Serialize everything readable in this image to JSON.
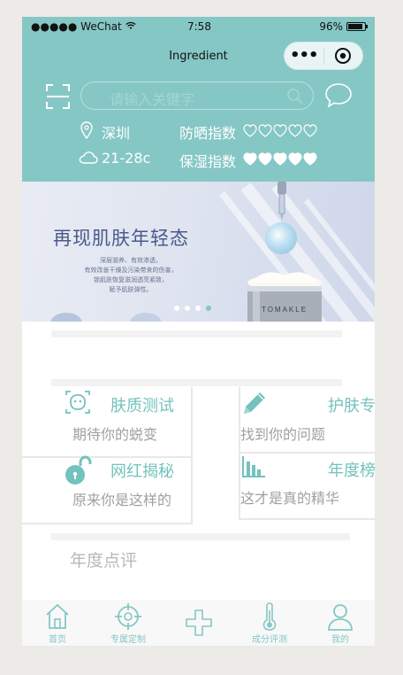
{
  "status": {
    "carrier": "●●●●● WeChat",
    "time": "7:58",
    "battery": "96%"
  },
  "nav": {
    "title": "Ingredient",
    "more": "•••"
  },
  "search": {
    "placeholder": "请输入关键字"
  },
  "info": {
    "city": "深圳",
    "temp": "21-28c",
    "sunscreen_label": "防晒指数",
    "sunscreen_level": 0,
    "moisture_label": "保湿指数",
    "moisture_level": 5,
    "max_level": 5
  },
  "banner": {
    "headline": "再现肌肤年轻态",
    "sub_lines": [
      "深层滋养、有效渗透，",
      "有效改善干燥及污染带来的伤害，",
      "锁肌肤恢复滋润透亮紧致，",
      "赋予肌肤弹性。"
    ],
    "jar_brand": "TOMAKLE",
    "dot_count": 4,
    "active_dot": 3
  },
  "features": [
    {
      "title": "肤质测试",
      "subtitle": "期待你的蜕变",
      "icon": "face-scan-icon"
    },
    {
      "title": "护肤专",
      "subtitle": "找到你的问题",
      "icon": "pencil-icon"
    },
    {
      "title": "网红揭秘",
      "subtitle": "原来你是这样的",
      "icon": "unlock-icon"
    },
    {
      "title": "年度榜",
      "subtitle": "这才是真的精华",
      "icon": "bar-chart-icon"
    }
  ],
  "section": {
    "annual_review": "年度点评"
  },
  "tabs": [
    {
      "label": "首页",
      "icon": "home-icon"
    },
    {
      "label": "专属定制",
      "icon": "target-icon"
    },
    {
      "label": "",
      "icon": "plus-icon"
    },
    {
      "label": "成分评测",
      "icon": "thermometer-icon"
    },
    {
      "label": "我的",
      "icon": "user-icon"
    }
  ],
  "colors": {
    "teal": "#85c7c5",
    "accent_text": "#74c2bd",
    "tab_label": "#85c7c5"
  }
}
